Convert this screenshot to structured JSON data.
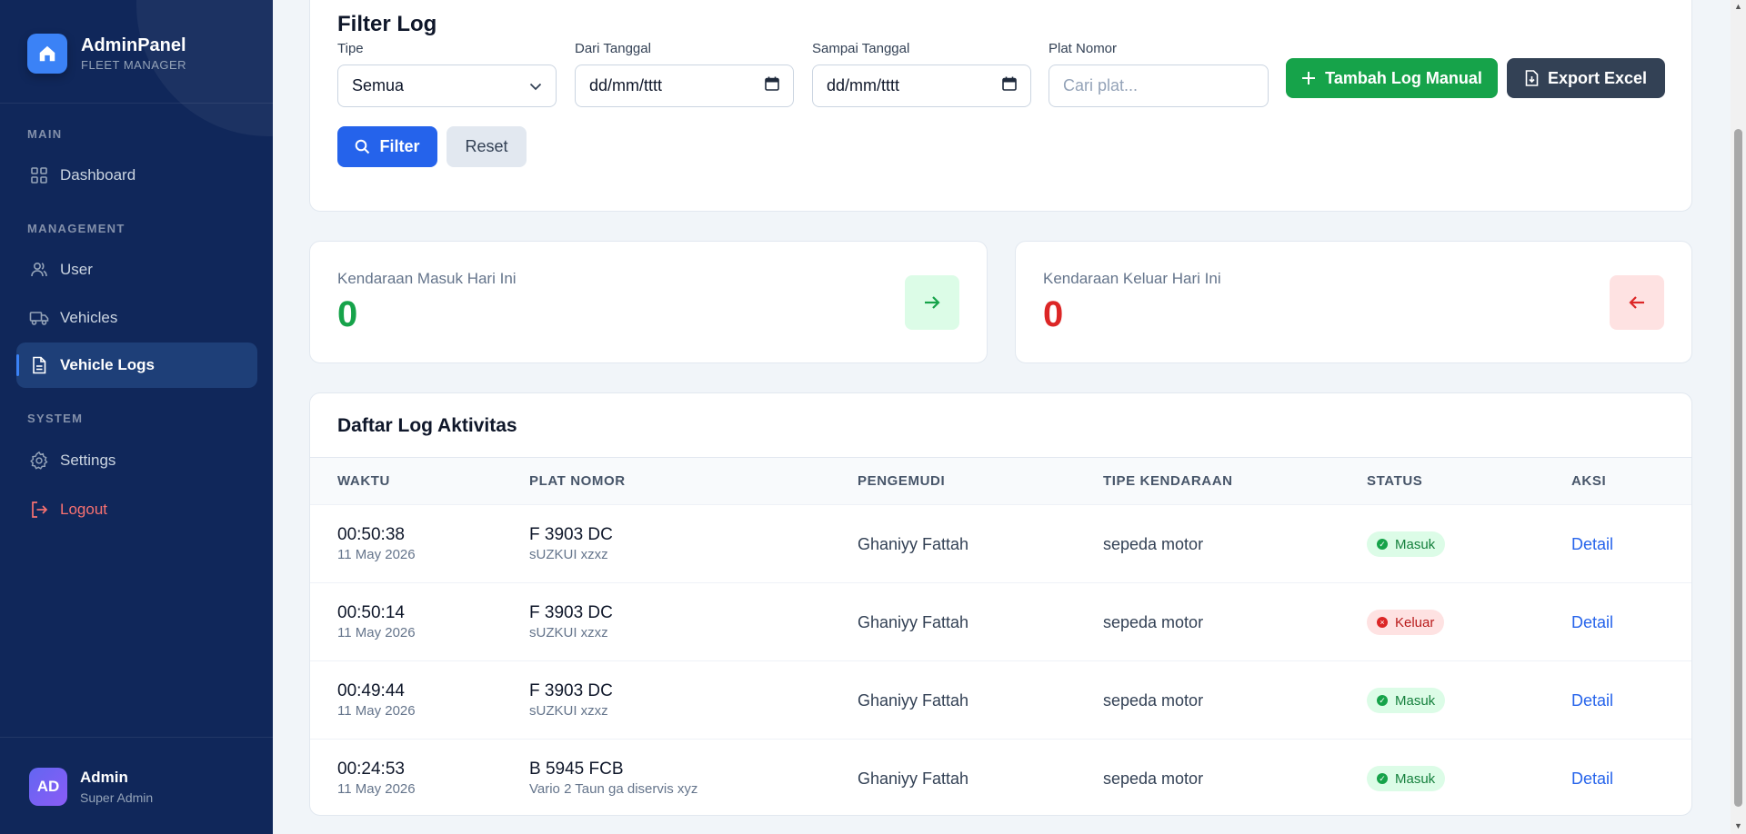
{
  "brand": {
    "title": "AdminPanel",
    "subtitle": "FLEET MANAGER",
    "icon": "home-icon",
    "accent": "#3b82f6"
  },
  "sidebar": {
    "sections": [
      {
        "label": "MAIN",
        "items": [
          {
            "label": "Dashboard",
            "icon": "grid-icon"
          }
        ]
      },
      {
        "label": "MANAGEMENT",
        "items": [
          {
            "label": "User",
            "icon": "users-icon"
          },
          {
            "label": "Vehicles",
            "icon": "truck-icon"
          },
          {
            "label": "Vehicle Logs",
            "icon": "document-icon",
            "active": true
          }
        ]
      },
      {
        "label": "SYSTEM",
        "items": [
          {
            "label": "Settings",
            "icon": "gear-icon"
          },
          {
            "label": "Logout",
            "icon": "logout-icon"
          }
        ]
      }
    ],
    "user": {
      "initials": "AD",
      "name": "Admin",
      "role": "Super Admin"
    }
  },
  "filter": {
    "title": "Filter Log",
    "type_label": "Tipe",
    "type_value": "Semua",
    "from_label": "Dari Tanggal",
    "from_value": "dd/mm/tttt",
    "to_label": "Sampai Tanggal",
    "to_value": "dd/mm/tttt",
    "plate_label": "Plat Nomor",
    "plate_placeholder": "Cari plat...",
    "add_button": "Tambah Log Manual",
    "export_button": "Export Excel",
    "filter_button": "Filter",
    "reset_button": "Reset"
  },
  "stats": {
    "in": {
      "label": "Kendaraan Masuk Hari Ini",
      "value": "0",
      "color": "#16a34a"
    },
    "out": {
      "label": "Kendaraan Keluar Hari Ini",
      "value": "0",
      "color": "#dc2626"
    }
  },
  "table": {
    "title": "Daftar Log Aktivitas",
    "columns": [
      "WAKTU",
      "PLAT NOMOR",
      "PENGEMUDI",
      "TIPE KENDARAAN",
      "STATUS",
      "AKSI"
    ],
    "rows": [
      {
        "time": "00:50:38",
        "date": "11 May 2026",
        "plate": "F 3903 DC",
        "note": "sUZKUI xzxz",
        "driver": "Ghaniyy Fattah",
        "type": "sepeda motor",
        "status": "Masuk",
        "action": "Detail"
      },
      {
        "time": "00:50:14",
        "date": "11 May 2026",
        "plate": "F 3903 DC",
        "note": "sUZKUI xzxz",
        "driver": "Ghaniyy Fattah",
        "type": "sepeda motor",
        "status": "Keluar",
        "action": "Detail"
      },
      {
        "time": "00:49:44",
        "date": "11 May 2026",
        "plate": "F 3903 DC",
        "note": "sUZKUI xzxz",
        "driver": "Ghaniyy Fattah",
        "type": "sepeda motor",
        "status": "Masuk",
        "action": "Detail"
      },
      {
        "time": "00:24:53",
        "date": "11 May 2026",
        "plate": "B 5945 FCB",
        "note": "Vario 2 Taun ga diservis xyz",
        "driver": "Ghaniyy Fattah",
        "type": "sepeda motor",
        "status": "Masuk",
        "action": "Detail"
      }
    ]
  }
}
